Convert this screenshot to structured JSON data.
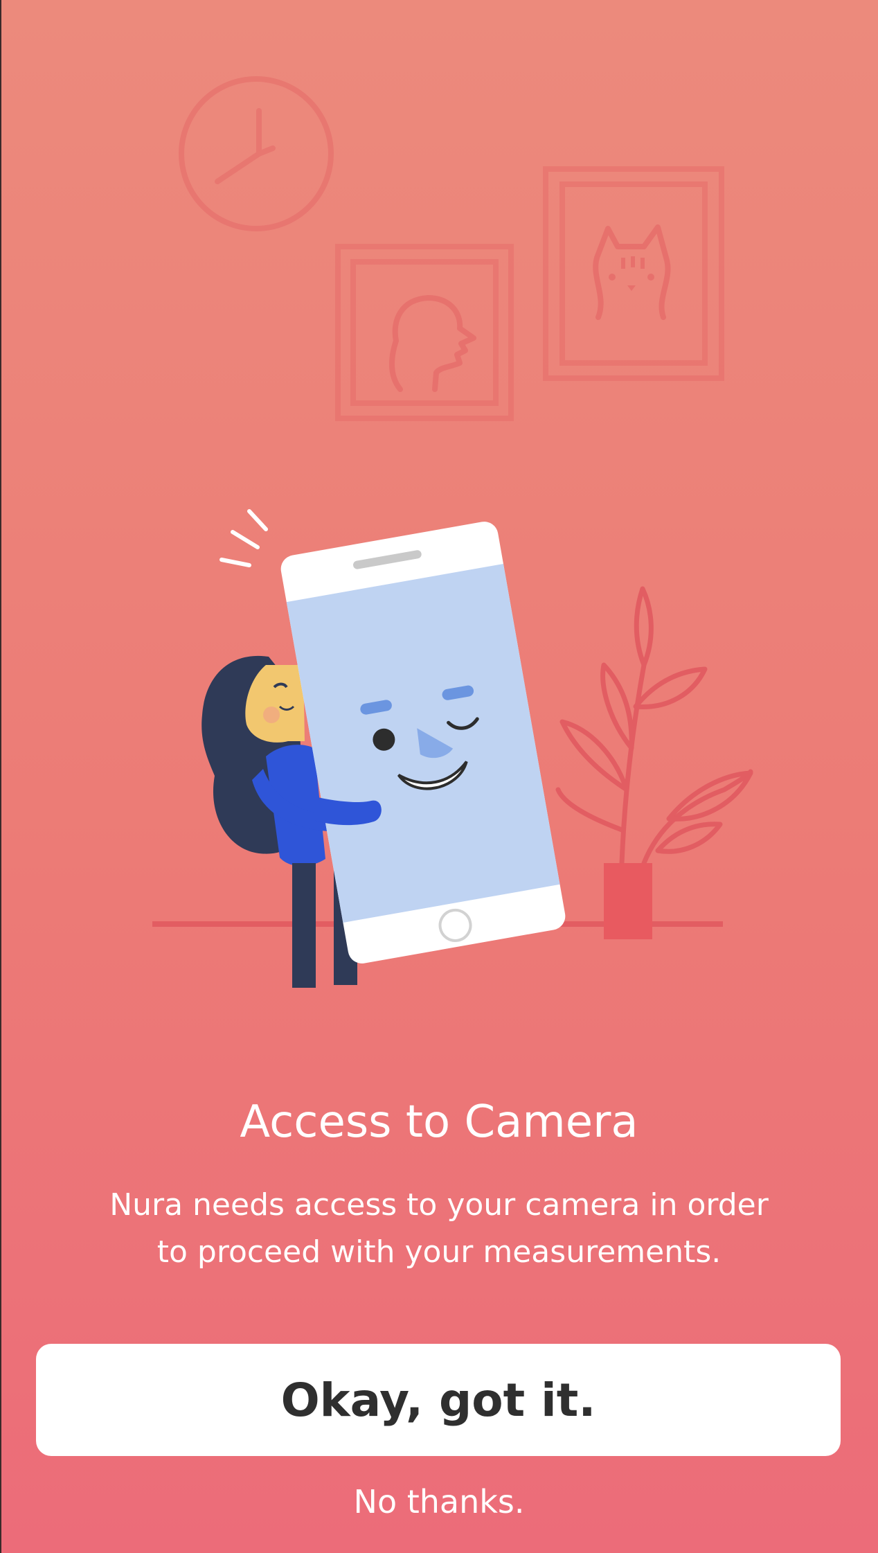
{
  "permission_prompt": {
    "title": "Access to Camera",
    "description": "Nura needs access to your camera in order to proceed with your measurements.",
    "primary_button_label": "Okay, got it.",
    "secondary_link_label": "No thanks."
  },
  "illustration": {
    "icons": [
      "clock-icon",
      "face-portrait-icon",
      "cat-portrait-icon",
      "plant-icon",
      "phone-icon",
      "person-icon"
    ]
  },
  "colors": {
    "background_top": "#ec8a7c",
    "background_bottom": "#ec6c79",
    "decor_line": "#e25d62",
    "phone_screen": "#bfd3f2",
    "accent_blue": "#2f55d8",
    "hair_dark": "#2f3a57"
  }
}
